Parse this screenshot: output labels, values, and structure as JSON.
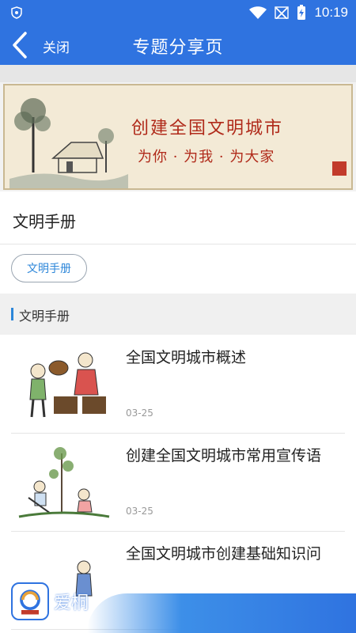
{
  "status_bar": {
    "time": "10:19"
  },
  "header": {
    "close_label": "关闭",
    "title": "专题分享页"
  },
  "banner": {
    "headline": "创建全国文明城市",
    "subline": "为你 · 为我 · 为大家"
  },
  "section": {
    "title": "文明手册"
  },
  "tags": [
    {
      "label": "文明手册"
    }
  ],
  "list": {
    "heading": "文明手册",
    "items": [
      {
        "title": "全国文明城市概述",
        "date": "03-25"
      },
      {
        "title": "创建全国文明城市常用宣传语",
        "date": "03-25"
      },
      {
        "title": "全国文明城市创建基础知识问",
        "date": ""
      }
    ]
  },
  "bottom_bar": {
    "brand": "爱桐"
  },
  "colors": {
    "primary": "#2f73e0",
    "accent": "#2c86d9",
    "banner_red": "#b02a1a"
  }
}
